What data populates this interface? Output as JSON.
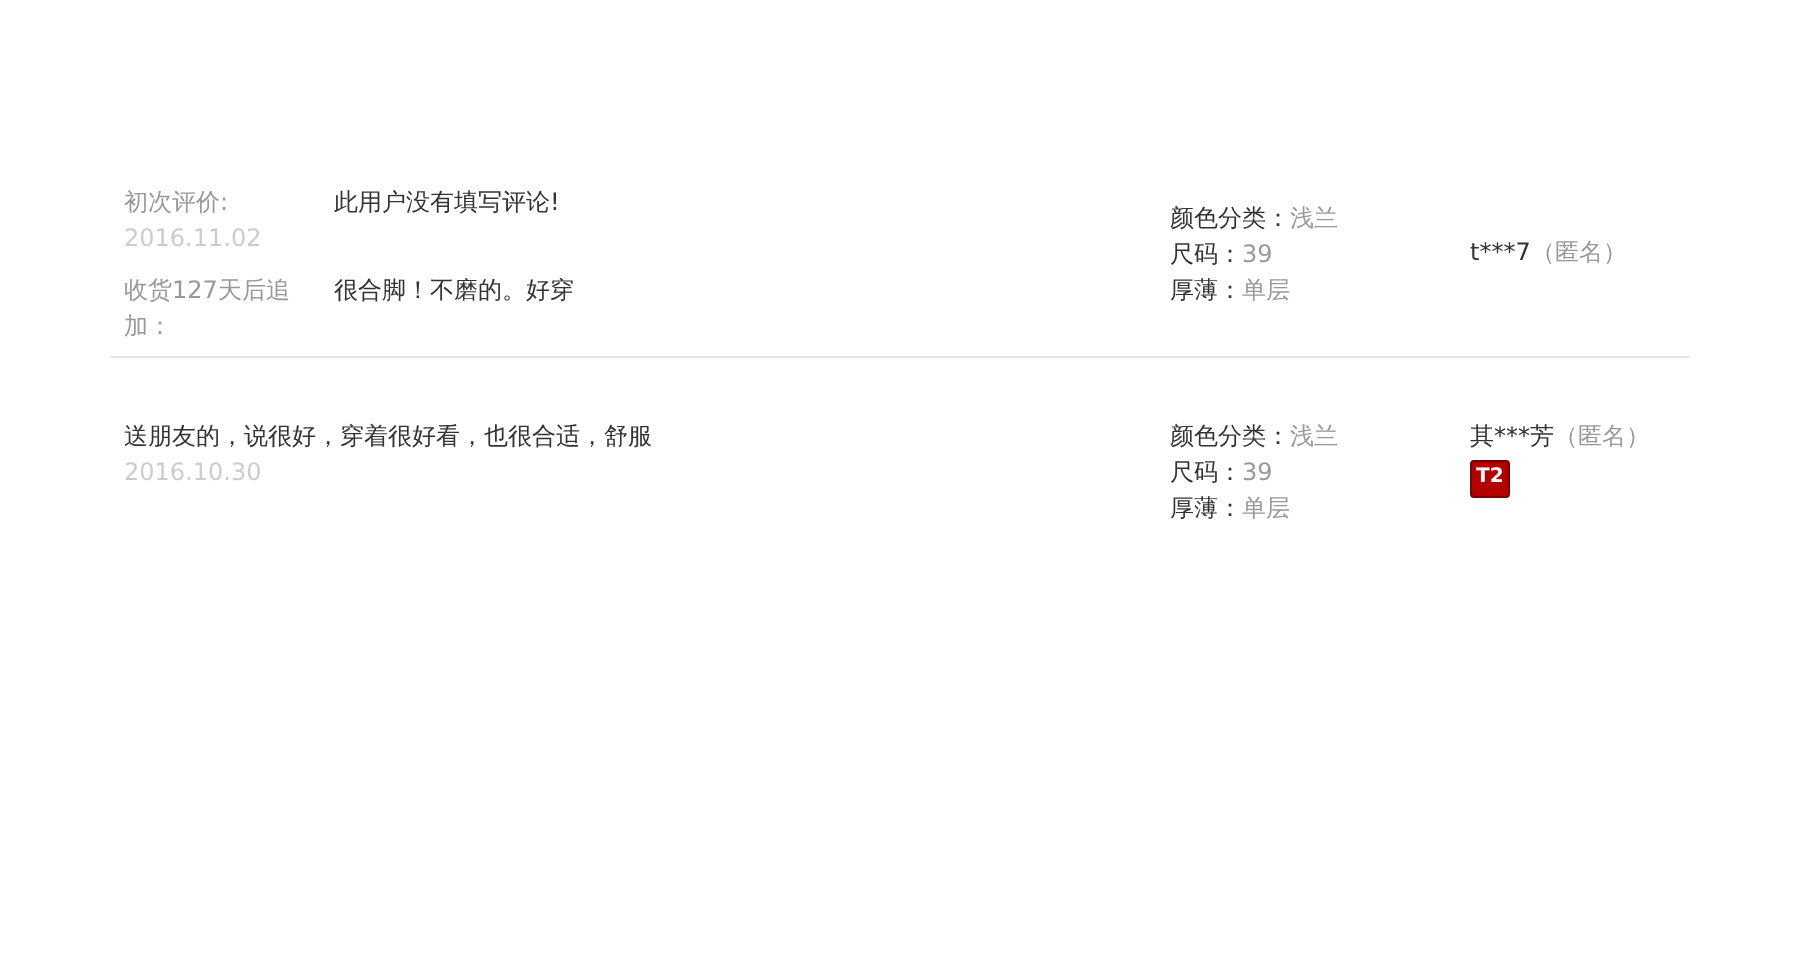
{
  "reviews": [
    {
      "kind": "appended",
      "initial": {
        "label": "初次评价:",
        "date": "2016.11.02",
        "text": "此用户没有填写评论!"
      },
      "append": {
        "label": "收货127天后追加：",
        "text": "很合脚！不磨的。好穿"
      },
      "attributes": [
        {
          "name": "颜色分类：",
          "value": "浅兰"
        },
        {
          "name": "尺码：",
          "value": "39"
        },
        {
          "name": "厚薄：",
          "value": "单层"
        }
      ],
      "user": {
        "name": "t***7",
        "anonymous": "（匿名）"
      }
    },
    {
      "kind": "single",
      "text": "送朋友的，说很好，穿着很好看，也很合适，舒服",
      "date": "2016.10.30",
      "attributes": [
        {
          "name": "颜色分类：",
          "value": "浅兰"
        },
        {
          "name": "尺码：",
          "value": "39"
        },
        {
          "name": "厚薄：",
          "value": "单层"
        }
      ],
      "user": {
        "name": "其***芳",
        "anonymous": "（匿名）",
        "level_badge": "T2"
      }
    }
  ]
}
